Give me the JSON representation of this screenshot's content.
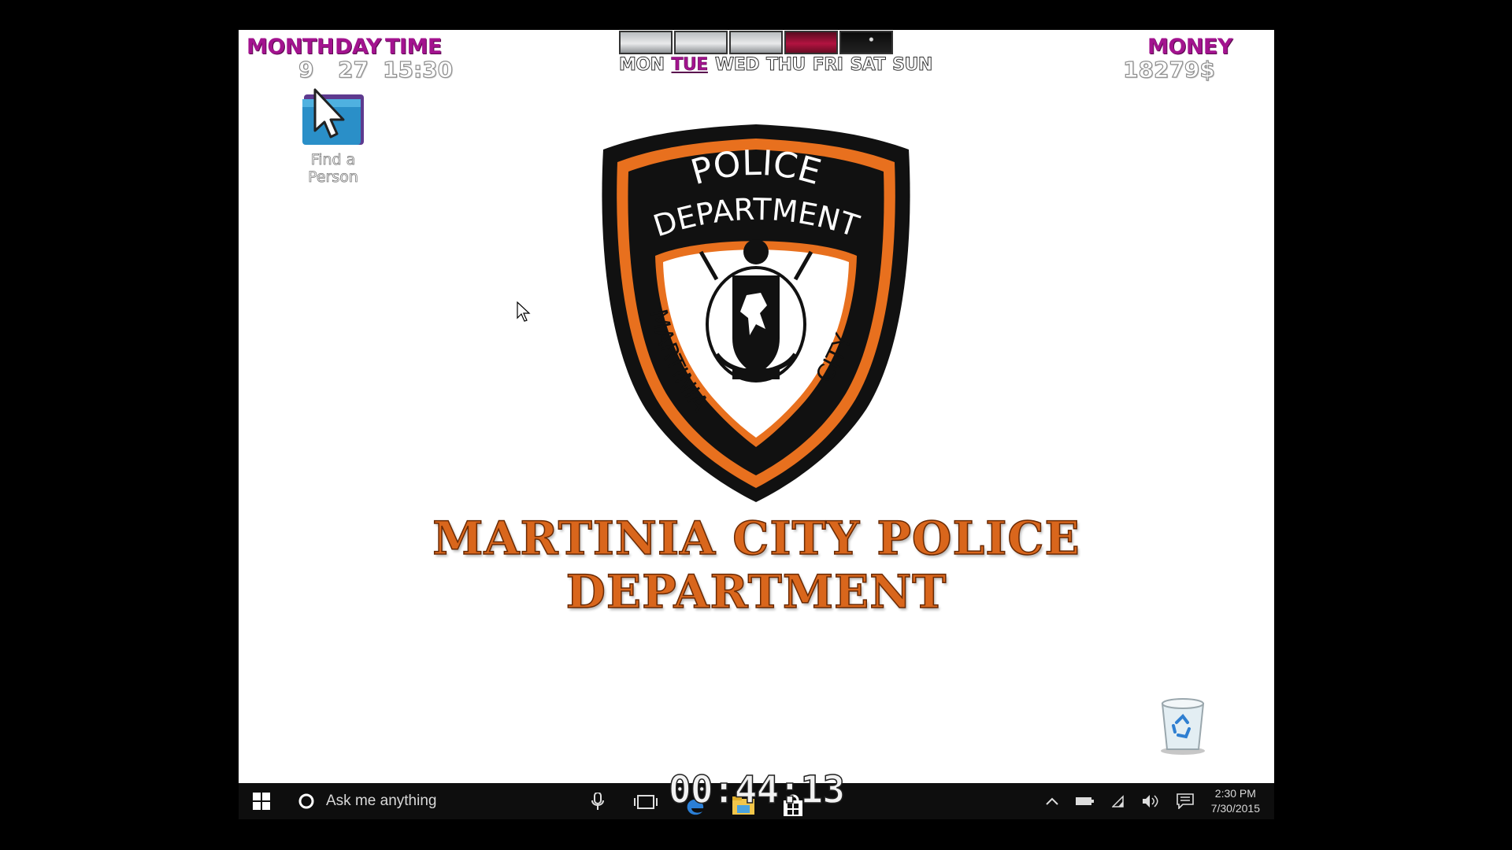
{
  "hud": {
    "month_label": "MONTH",
    "day_label": "DAY",
    "time_label": "TIME",
    "month_value": "9",
    "day_value": "27",
    "time_value": "15:30",
    "money_label": "MONEY",
    "money_value": "18279$"
  },
  "week": {
    "days": [
      "MON",
      "TUE",
      "WED",
      "THU",
      "FRI",
      "SAT",
      "SUN"
    ],
    "active_day": "TUE",
    "weather_icons": [
      "cloudy-icon",
      "cloudy-icon",
      "cloudy-icon",
      "sunset-icon",
      "night-icon"
    ]
  },
  "desktop": {
    "find_person_label": "Find a Person",
    "recycle_bin_icon": "recycle-bin-icon"
  },
  "badge": {
    "top_text_1": "POLICE",
    "top_text_2": "DEPARTMENT",
    "left_text": "MARTINIA",
    "right_text": "CITY",
    "colors": {
      "outer": "#111111",
      "ring": "#e8701e",
      "inner": "#ffffff"
    }
  },
  "title": "MARTINIA CITY POLICE DEPARTMENT",
  "timer": "00:44:13",
  "taskbar": {
    "search_placeholder": "Ask me anything",
    "clock_time": "2:30 PM",
    "clock_date": "7/30/2015"
  }
}
